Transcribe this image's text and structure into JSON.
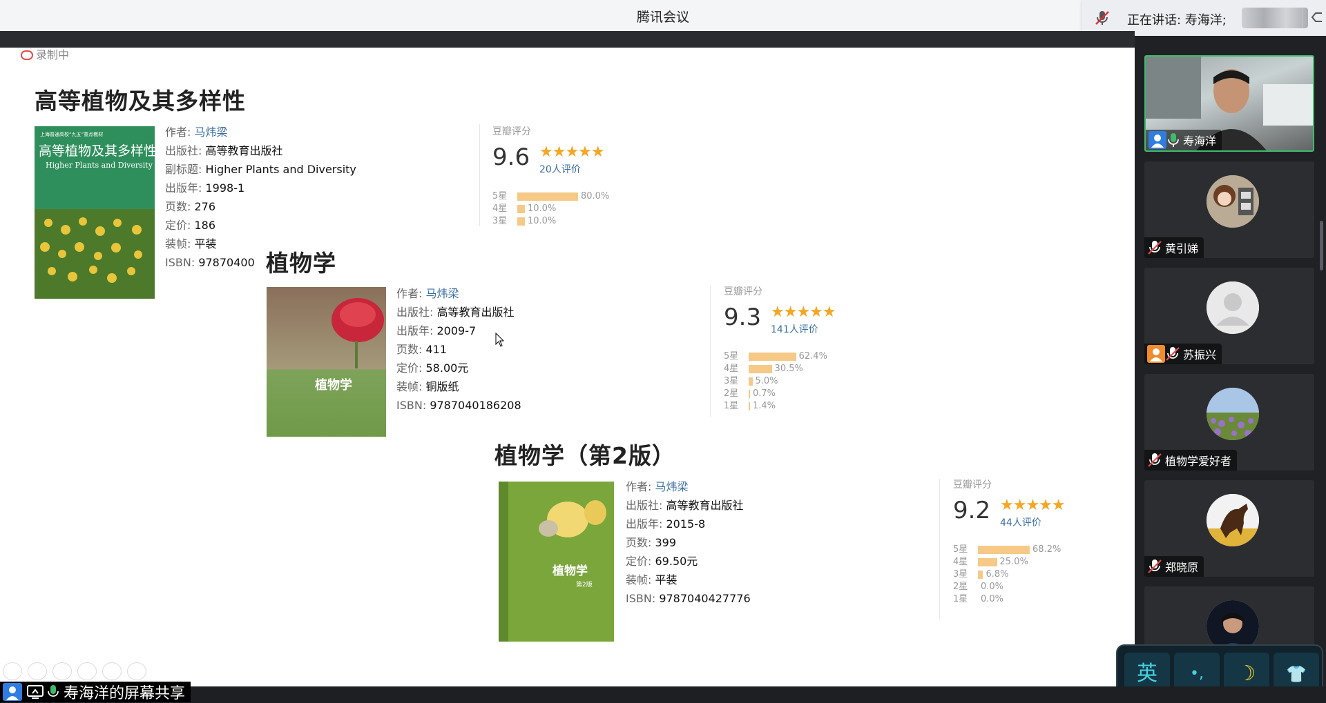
{
  "app": {
    "title": "腾讯会议"
  },
  "speaking": {
    "text": "正在讲话: 寿海洋;"
  },
  "recording": {
    "text": "录制中"
  },
  "share_label": "寿海洋的屏幕共享",
  "ime": {
    "lang": "英",
    "punct": "•,",
    "moon": "☽",
    "shirt": "👕"
  },
  "participants": [
    {
      "name": "寿海洋",
      "mic": "on",
      "role_icon": "person",
      "active": true
    },
    {
      "name": "黄引娣",
      "mic": "off"
    },
    {
      "name": "苏振兴",
      "mic": "off",
      "role_icon": "person-orange"
    },
    {
      "name": "植物学爱好者",
      "mic": "off"
    },
    {
      "name": "郑晓原",
      "mic": "off"
    },
    {
      "name": "",
      "mic": ""
    }
  ],
  "books": [
    {
      "title": "高等植物及其多样性",
      "cover_title": "高等植物及其多样性",
      "cover_sub": "Higher Plants and Diversity",
      "cover_top": "上海普通高校“九五”重点教材",
      "author_label": "作者:",
      "author": "马炜梁",
      "publisher_label": "出版社:",
      "publisher": "高等教育出版社",
      "subtitle_label": "副标题:",
      "subtitle": "Higher Plants and Diversity",
      "year_label": "出版年:",
      "year": "1998-1",
      "pages_label": "页数:",
      "pages": "276",
      "price_label": "定价:",
      "price": "186",
      "binding_label": "装帧:",
      "binding": "平装",
      "isbn_label": "ISBN:",
      "isbn": "97870400",
      "rating_head": "豆瓣评分",
      "score": "9.6",
      "stars": "★★★★★",
      "count": "20人评价",
      "dist": [
        {
          "label": "5星",
          "pct": "80.0%",
          "v": 80.0
        },
        {
          "label": "4星",
          "pct": "10.0%",
          "v": 10.0
        },
        {
          "label": "3星",
          "pct": "10.0%",
          "v": 10.0
        }
      ]
    },
    {
      "title": "植物学",
      "cover_title": "植物学",
      "author_label": "作者:",
      "author": "马炜梁",
      "publisher_label": "出版社:",
      "publisher": "高等教育出版社",
      "year_label": "出版年:",
      "year": "2009-7",
      "pages_label": "页数:",
      "pages": "411",
      "price_label": "定价:",
      "price": "58.00元",
      "binding_label": "装帧:",
      "binding": "铜版纸",
      "isbn_label": "ISBN:",
      "isbn": "9787040186208",
      "rating_head": "豆瓣评分",
      "score": "9.3",
      "stars": "★★★★★",
      "count": "141人评价",
      "dist": [
        {
          "label": "5星",
          "pct": "62.4%",
          "v": 62.4
        },
        {
          "label": "4星",
          "pct": "30.5%",
          "v": 30.5
        },
        {
          "label": "3星",
          "pct": "5.0%",
          "v": 5.0
        },
        {
          "label": "2星",
          "pct": "0.7%",
          "v": 0.7
        },
        {
          "label": "1星",
          "pct": "1.4%",
          "v": 1.4
        }
      ]
    },
    {
      "title": "植物学（第2版）",
      "cover_title": "植物学",
      "cover_edition": "第2版",
      "author_label": "作者:",
      "author": "马炜梁",
      "publisher_label": "出版社:",
      "publisher": "高等教育出版社",
      "year_label": "出版年:",
      "year": "2015-8",
      "pages_label": "页数:",
      "pages": "399",
      "price_label": "定价:",
      "price": "69.50元",
      "binding_label": "装帧:",
      "binding": "平装",
      "isbn_label": "ISBN:",
      "isbn": "9787040427776",
      "rating_head": "豆瓣评分",
      "score": "9.2",
      "stars": "★★★★★",
      "count": "44人评价",
      "dist": [
        {
          "label": "5星",
          "pct": "68.2%",
          "v": 68.2
        },
        {
          "label": "4星",
          "pct": "25.0%",
          "v": 25.0
        },
        {
          "label": "3星",
          "pct": "6.8%",
          "v": 6.8
        },
        {
          "label": "2星",
          "pct": "0.0%",
          "v": 0.0
        },
        {
          "label": "1星",
          "pct": "0.0%",
          "v": 0.0
        }
      ]
    }
  ]
}
